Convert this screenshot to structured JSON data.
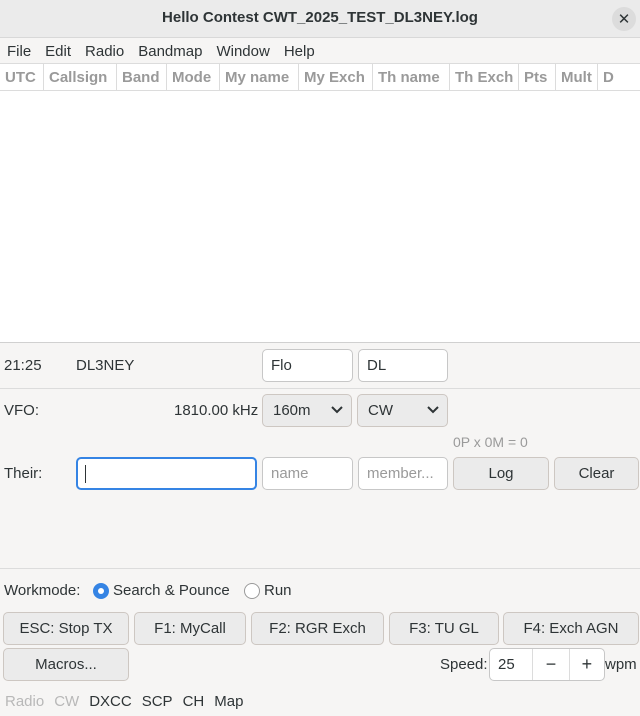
{
  "window": {
    "title": "Hello Contest CWT_2025_TEST_DL3NEY.log",
    "close_glyph": "✕"
  },
  "menu": [
    "File",
    "Edit",
    "Radio",
    "Bandmap",
    "Window",
    "Help"
  ],
  "log_table": {
    "columns": [
      "UTC",
      "Callsign",
      "Band",
      "Mode",
      "My name",
      "My Exch",
      "Th name",
      "Th Exch",
      "Pts",
      "Mult",
      "D"
    ],
    "rows": []
  },
  "station": {
    "time": "21:25",
    "callsign": "DL3NEY",
    "my_name": "Flo",
    "my_exch": "DL"
  },
  "vfo": {
    "label": "VFO:",
    "frequency": "1810.00 kHz",
    "band": "160m",
    "mode": "CW"
  },
  "score": "0P x 0M = 0",
  "their": {
    "label": "Their:",
    "callsign_value": "",
    "name_placeholder": "name",
    "exch_placeholder": "member...",
    "log_label": "Log",
    "clear_label": "Clear"
  },
  "workmode": {
    "label": "Workmode:",
    "options": [
      "Search & Pounce",
      "Run"
    ],
    "selected": "Search & Pounce"
  },
  "macros": {
    "buttons": [
      "ESC: Stop TX",
      "F1: MyCall",
      "F2: RGR Exch",
      "F3: TU GL",
      "F4: Exch AGN"
    ],
    "macros_label": "Macros..."
  },
  "speed": {
    "label": "Speed:",
    "value": "25",
    "unit": "wpm",
    "minus": "−",
    "plus": "+"
  },
  "tabs": [
    {
      "label": "Radio",
      "enabled": false
    },
    {
      "label": "CW",
      "enabled": false
    },
    {
      "label": "DXCC",
      "enabled": true
    },
    {
      "label": "SCP",
      "enabled": true
    },
    {
      "label": "CH",
      "enabled": true
    },
    {
      "label": "Map",
      "enabled": true
    }
  ]
}
